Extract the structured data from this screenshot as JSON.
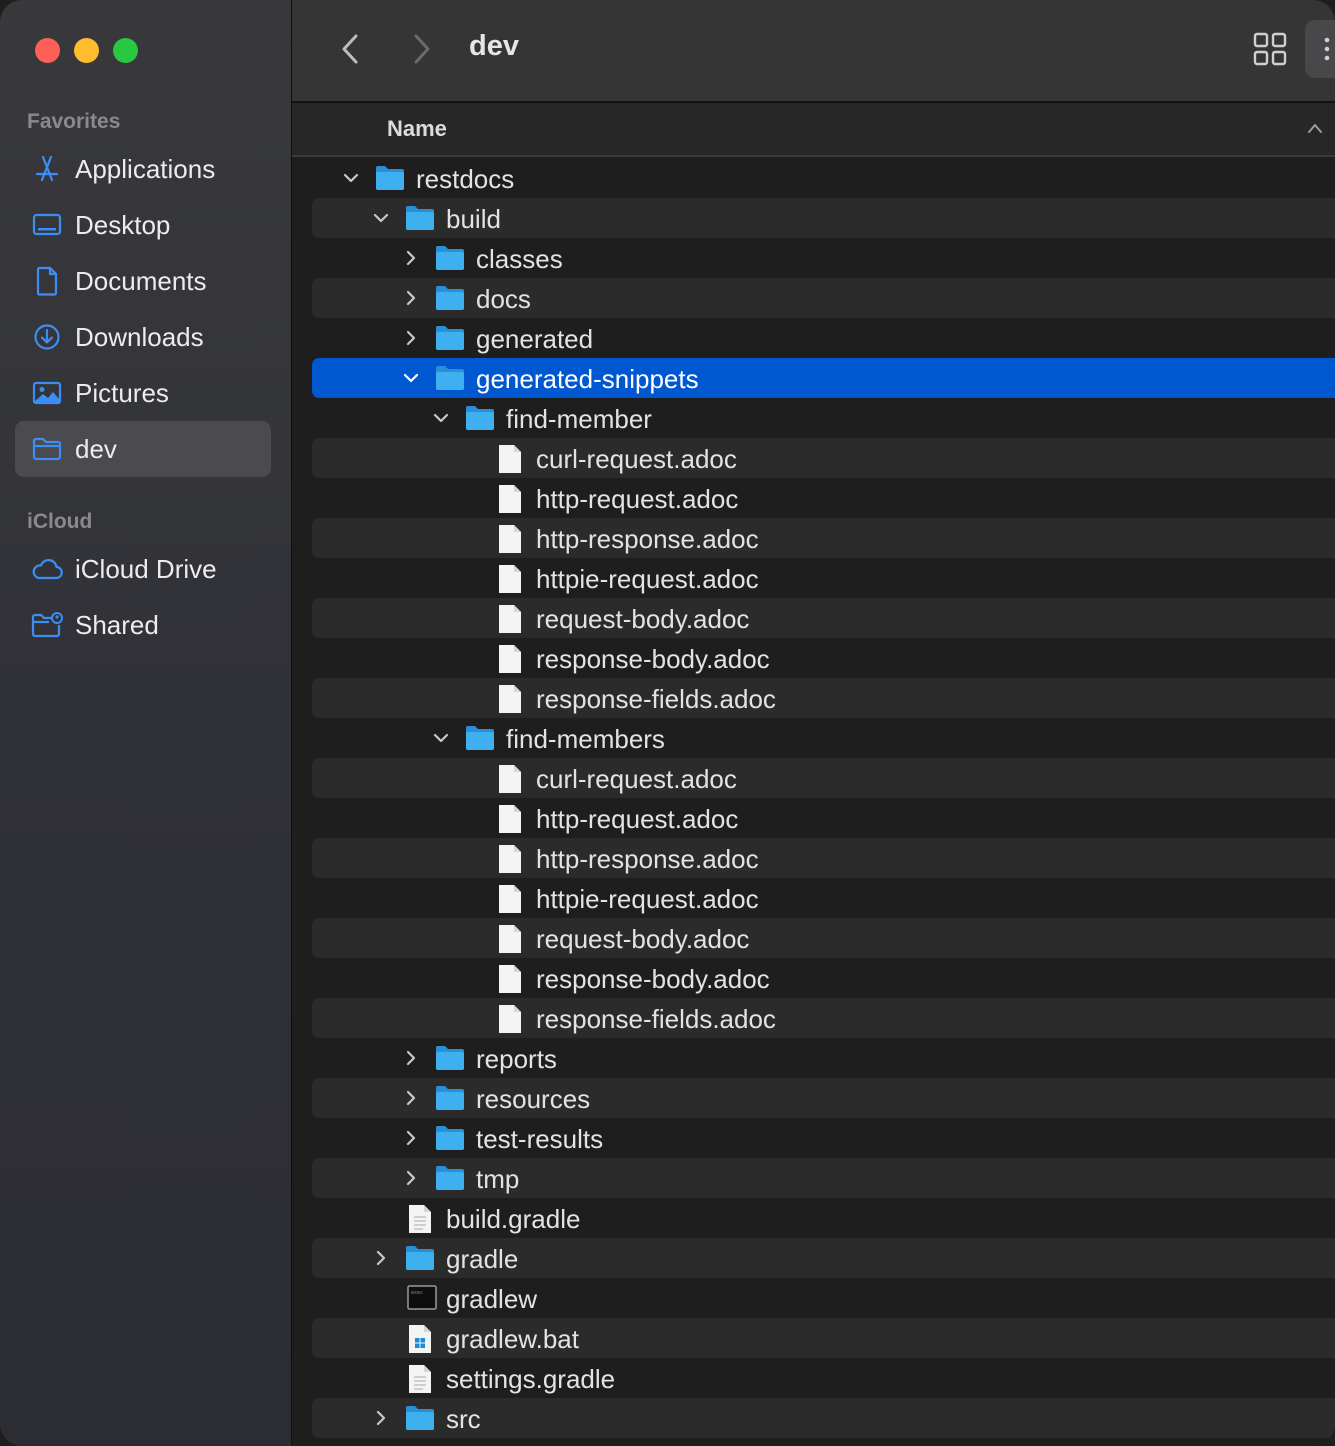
{
  "window": {
    "title": "dev"
  },
  "sidebar": {
    "favorites_header": "Favorites",
    "icloud_header": "iCloud",
    "favorites": [
      {
        "label": "Applications",
        "icon": "applications-icon"
      },
      {
        "label": "Desktop",
        "icon": "desktop-icon"
      },
      {
        "label": "Documents",
        "icon": "document-icon"
      },
      {
        "label": "Downloads",
        "icon": "downloads-icon"
      },
      {
        "label": "Pictures",
        "icon": "pictures-icon"
      },
      {
        "label": "dev",
        "icon": "folder-icon",
        "active": true
      }
    ],
    "icloud": [
      {
        "label": "iCloud Drive",
        "icon": "cloud-icon"
      },
      {
        "label": "Shared",
        "icon": "shared-folder-icon"
      }
    ]
  },
  "list": {
    "column_header": "Name",
    "rows": [
      {
        "name": "restdocs",
        "type": "folder",
        "depth": 0,
        "expanded": true
      },
      {
        "name": "build",
        "type": "folder",
        "depth": 1,
        "expanded": true
      },
      {
        "name": "classes",
        "type": "folder",
        "depth": 2,
        "expanded": false
      },
      {
        "name": "docs",
        "type": "folder",
        "depth": 2,
        "expanded": false
      },
      {
        "name": "generated",
        "type": "folder",
        "depth": 2,
        "expanded": false
      },
      {
        "name": "generated-snippets",
        "type": "folder",
        "depth": 2,
        "expanded": true,
        "selected": true
      },
      {
        "name": "find-member",
        "type": "folder",
        "depth": 3,
        "expanded": true
      },
      {
        "name": "curl-request.adoc",
        "type": "file",
        "depth": 4
      },
      {
        "name": "http-request.adoc",
        "type": "file",
        "depth": 4
      },
      {
        "name": "http-response.adoc",
        "type": "file",
        "depth": 4
      },
      {
        "name": "httpie-request.adoc",
        "type": "file",
        "depth": 4
      },
      {
        "name": "request-body.adoc",
        "type": "file",
        "depth": 4
      },
      {
        "name": "response-body.adoc",
        "type": "file",
        "depth": 4
      },
      {
        "name": "response-fields.adoc",
        "type": "file",
        "depth": 4
      },
      {
        "name": "find-members",
        "type": "folder",
        "depth": 3,
        "expanded": true
      },
      {
        "name": "curl-request.adoc",
        "type": "file",
        "depth": 4
      },
      {
        "name": "http-request.adoc",
        "type": "file",
        "depth": 4
      },
      {
        "name": "http-response.adoc",
        "type": "file",
        "depth": 4
      },
      {
        "name": "httpie-request.adoc",
        "type": "file",
        "depth": 4
      },
      {
        "name": "request-body.adoc",
        "type": "file",
        "depth": 4
      },
      {
        "name": "response-body.adoc",
        "type": "file",
        "depth": 4
      },
      {
        "name": "response-fields.adoc",
        "type": "file",
        "depth": 4
      },
      {
        "name": "reports",
        "type": "folder",
        "depth": 2,
        "expanded": false
      },
      {
        "name": "resources",
        "type": "folder",
        "depth": 2,
        "expanded": false
      },
      {
        "name": "test-results",
        "type": "folder",
        "depth": 2,
        "expanded": false
      },
      {
        "name": "tmp",
        "type": "folder",
        "depth": 2,
        "expanded": false
      },
      {
        "name": "build.gradle",
        "type": "text-file",
        "depth": 1
      },
      {
        "name": "gradle",
        "type": "folder",
        "depth": 1,
        "expanded": false
      },
      {
        "name": "gradlew",
        "type": "exec",
        "depth": 1
      },
      {
        "name": "gradlew.bat",
        "type": "bat-file",
        "depth": 1
      },
      {
        "name": "settings.gradle",
        "type": "text-file",
        "depth": 1
      },
      {
        "name": "src",
        "type": "folder",
        "depth": 1,
        "expanded": false
      }
    ]
  },
  "colors": {
    "selection": "#0058d1",
    "folder": "#3fb0ef",
    "sidebar_icon": "#3a8ef6"
  }
}
